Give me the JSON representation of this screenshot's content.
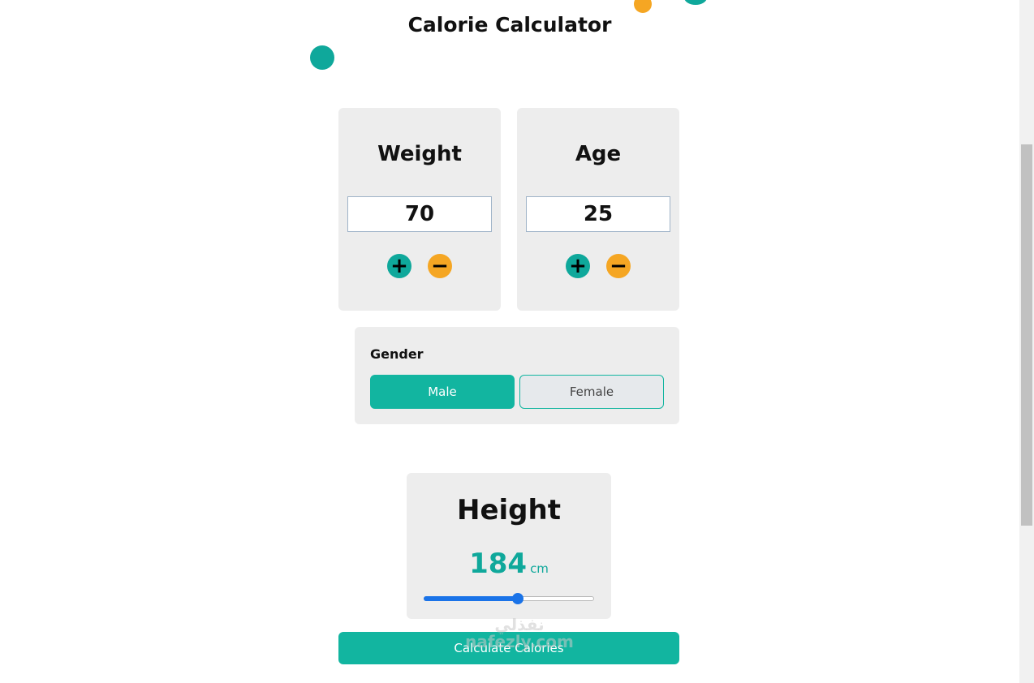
{
  "page": {
    "title": "Calorie Calculator"
  },
  "weight": {
    "label": "Weight",
    "value": "70",
    "plus": "+",
    "minus": "−"
  },
  "age": {
    "label": "Age",
    "value": "25",
    "plus": "+",
    "minus": "−"
  },
  "gender": {
    "label": "Gender",
    "options": [
      "Male",
      "Female"
    ],
    "selected": "Male"
  },
  "height": {
    "label": "Height",
    "value": "184",
    "unit": "cm",
    "slider_fraction": 0.55
  },
  "actions": {
    "calculate_label": "Calculate Calories"
  },
  "watermark": {
    "line1": "نفذلي",
    "line2": "nafezly.com"
  },
  "colors": {
    "accent": "#0fa89b",
    "secondary": "#f5a623",
    "button": "#12b5a0",
    "slider": "#1a73e8"
  }
}
